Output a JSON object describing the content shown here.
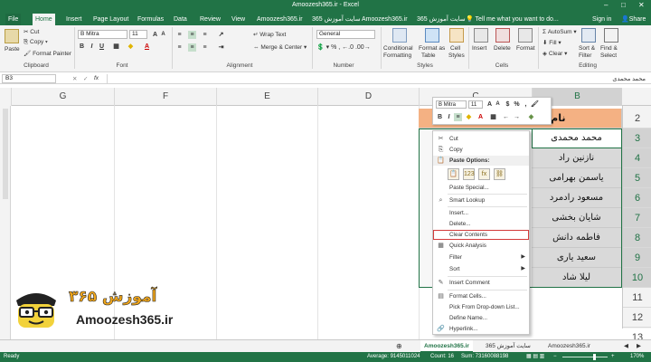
{
  "window": {
    "title": "Amoozesh365.ir - Excel",
    "controls": [
      "–",
      "□",
      "✕"
    ],
    "theme_color": "#217346"
  },
  "tabs": [
    "File",
    "Home",
    "Insert",
    "Page Layout",
    "Formulas",
    "Data",
    "Review",
    "View",
    "Amoozesh365.ir",
    "سایت آموزش 365",
    "Amoozesh365.ir",
    "سایت آموزش 365"
  ],
  "tell_me": "Tell me what you want to do...",
  "account": {
    "sign_in": "Sign in",
    "share": "Share"
  },
  "ribbon": {
    "clipboard": {
      "paste": "Paste",
      "cut": "Cut",
      "copy": "Copy",
      "format_painter": "Format Painter",
      "label": "Clipboard"
    },
    "font": {
      "name": "B Mitra",
      "size": "11",
      "label": "Font"
    },
    "alignment": {
      "wrap": "Wrap Text",
      "merge": "Merge & Center",
      "label": "Alignment"
    },
    "number": {
      "format": "General",
      "label": "Number"
    },
    "styles": {
      "conditional": [
        "Conditional",
        "Formatting"
      ],
      "format_table": [
        "Format as",
        "Table"
      ],
      "cell_styles": [
        "Cell",
        "Styles"
      ],
      "label": "Styles"
    },
    "cells": {
      "insert": "Insert",
      "delete": "Delete",
      "format": "Format",
      "label": "Cells"
    },
    "editing": {
      "autosum": "AutoSum",
      "fill": "Fill",
      "clear": "Clear",
      "sort": [
        "Sort &",
        "Filter"
      ],
      "find": [
        "Find &",
        "Select"
      ],
      "label": "Editing"
    }
  },
  "formula_bar": {
    "name_box": "B3",
    "fx": "fx",
    "value": "محمد محمدی"
  },
  "columns": [
    "G",
    "F",
    "E",
    "D",
    "C",
    "B"
  ],
  "rows": [
    "2",
    "3",
    "4",
    "5",
    "6",
    "7",
    "8",
    "9",
    "10",
    "11",
    "12",
    "13"
  ],
  "table": {
    "header": "نام و نام خانوادگی",
    "header_fill": "#f4b183",
    "names": [
      "محمد محمدی",
      "نازنین راد",
      "یاسمن بهرامی",
      "مسعود رادمرد",
      "شایان بخشی",
      "فاطمه دانش",
      "سعید یاری",
      "لیلا شاد"
    ]
  },
  "mini_toolbar": {
    "font": "B Mitra",
    "size": "11"
  },
  "context_menu": {
    "items": [
      {
        "label": "Cut",
        "icon": "✂"
      },
      {
        "label": "Copy",
        "icon": "⎘"
      },
      {
        "label": "Paste Options:",
        "icon": "📋"
      },
      {
        "label": "Paste Special...",
        "icon": ""
      },
      {
        "label": "Smart Lookup",
        "icon": "⌕"
      },
      {
        "label": "Insert...",
        "icon": ""
      },
      {
        "label": "Delete...",
        "icon": ""
      },
      {
        "label": "Clear Contents",
        "icon": ""
      },
      {
        "label": "Quick Analysis",
        "icon": "▦"
      },
      {
        "label": "Filter",
        "icon": ""
      },
      {
        "label": "Sort",
        "icon": ""
      },
      {
        "label": "Insert Comment",
        "icon": "✎"
      },
      {
        "label": "Format Cells...",
        "icon": "▤"
      },
      {
        "label": "Pick From Drop-down List...",
        "icon": ""
      },
      {
        "label": "Define Name...",
        "icon": ""
      },
      {
        "label": "Hyperlink...",
        "icon": "🔗"
      }
    ]
  },
  "sheet_tabs": [
    "Amoozesh365.ir",
    "سایت آموزش 365",
    "Amoozesh365.ir"
  ],
  "status": {
    "ready": "Ready",
    "average": "Average: 9145011024",
    "count": "Count: 16",
    "sum": "Sum: 73160088198",
    "zoom": "170%"
  },
  "logo": {
    "persian": "آموزش ۳۶۵",
    "latin": "Amoozesh365.ir"
  }
}
